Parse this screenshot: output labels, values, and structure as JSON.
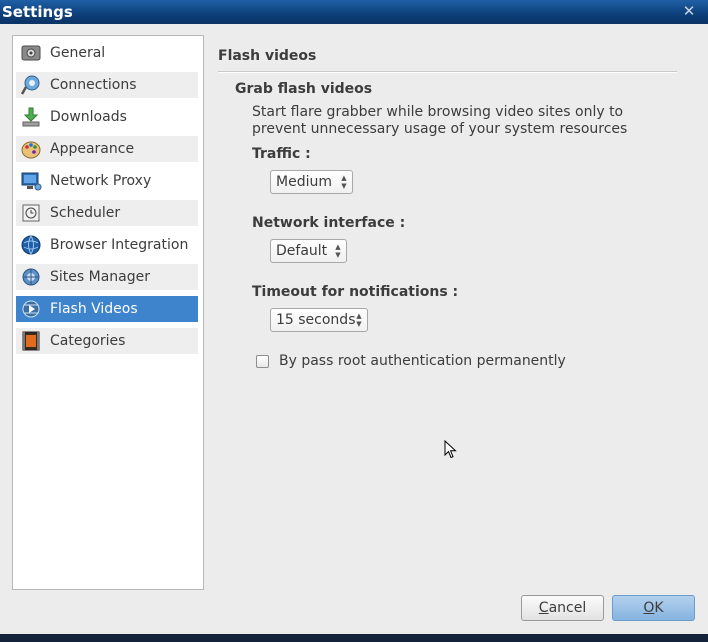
{
  "window": {
    "title": "Settings",
    "close_glyph": "✕"
  },
  "sidebar": {
    "items": [
      {
        "label": "General",
        "icon": "general-icon"
      },
      {
        "label": "Connections",
        "icon": "connections-icon"
      },
      {
        "label": "Downloads",
        "icon": "downloads-icon"
      },
      {
        "label": "Appearance",
        "icon": "appearance-icon"
      },
      {
        "label": "Network Proxy",
        "icon": "network-proxy-icon"
      },
      {
        "label": "Scheduler",
        "icon": "scheduler-icon"
      },
      {
        "label": "Browser Integration",
        "icon": "browser-integration-icon"
      },
      {
        "label": "Sites Manager",
        "icon": "sites-manager-icon"
      },
      {
        "label": "Flash Videos",
        "icon": "flash-videos-icon"
      },
      {
        "label": "Categories",
        "icon": "categories-icon"
      }
    ],
    "selected": "Flash Videos"
  },
  "content": {
    "section_title": "Flash videos",
    "group_title": "Grab flash videos",
    "description": "Start flare grabber while browsing video sites only to prevent unnecessary usage of your system resources",
    "traffic": {
      "label": "Traffic :",
      "value": "Medium"
    },
    "network_interface": {
      "label": "Network interface :",
      "value": "Default"
    },
    "timeout": {
      "label": "Timeout for notifications :",
      "value": "15 seconds"
    },
    "bypass": {
      "label": "By pass root authentication permanently",
      "checked": false
    }
  },
  "buttons": {
    "cancel_prefix": "",
    "cancel_underlined": "C",
    "cancel_rest": "ancel",
    "ok_underlined": "O",
    "ok_rest": "K"
  },
  "colors": {
    "selection": "#3d84cc",
    "titlebar": "#0d3f78"
  }
}
